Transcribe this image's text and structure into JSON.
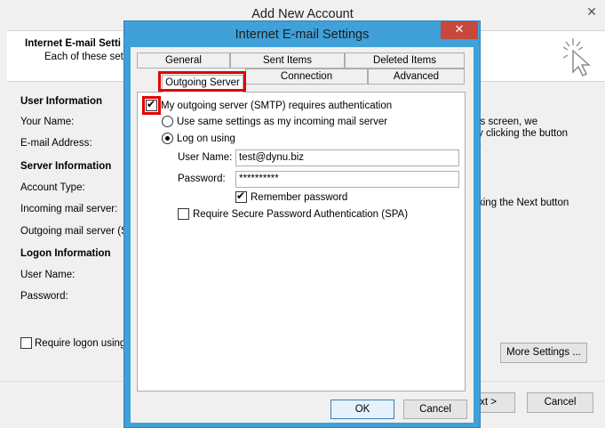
{
  "background_window": {
    "title": "Add New Account",
    "close_glyph": "✕",
    "header_title": "Internet E-mail Setti",
    "header_subtitle": "Each of these setti",
    "sections": {
      "user_information": "User Information",
      "server_information": "Server Information",
      "logon_information": "Logon Information"
    },
    "labels": {
      "your_name": "Your Name:",
      "email_address": "E-mail Address:",
      "account_type": "Account Type:",
      "incoming_server": "Incoming mail server:",
      "outgoing_server": "Outgoing mail server (SM",
      "user_name": "User Name:",
      "password": "Password:"
    },
    "right_text": {
      "line1": "is screen, we",
      "line2": "y clicking the button",
      "line3": ")",
      "line4": "king the Next button"
    },
    "require_logon": "Require logon using S",
    "more_settings": "More Settings ...",
    "next_button": "xt >",
    "cancel_button": "Cancel"
  },
  "dialog": {
    "title": "Internet E-mail Settings",
    "close_glyph": "✕",
    "tabs_row1": [
      "General",
      "Sent Items",
      "Deleted Items"
    ],
    "tabs_row2": [
      "Outgoing Server",
      "Connection",
      "Advanced"
    ],
    "active_tab": "Outgoing Server",
    "smtp_auth": {
      "label": "My outgoing server (SMTP) requires authentication",
      "checked": true
    },
    "same_settings": {
      "label": "Use same settings as my incoming mail server",
      "selected": false
    },
    "log_on_using": {
      "label": "Log on using",
      "selected": true
    },
    "user_name_label": "User Name:",
    "user_name_value": "test@dynu.biz",
    "password_label": "Password:",
    "password_value": "**********",
    "remember_password": {
      "label": "Remember password",
      "checked": true
    },
    "spa": {
      "label": "Require Secure Password Authentication (SPA)",
      "checked": false
    },
    "ok_button": "OK",
    "cancel_button": "Cancel"
  },
  "colors": {
    "dialog_frame": "#40a0d8",
    "close_button": "#c7483d",
    "highlight": "#e00000"
  }
}
